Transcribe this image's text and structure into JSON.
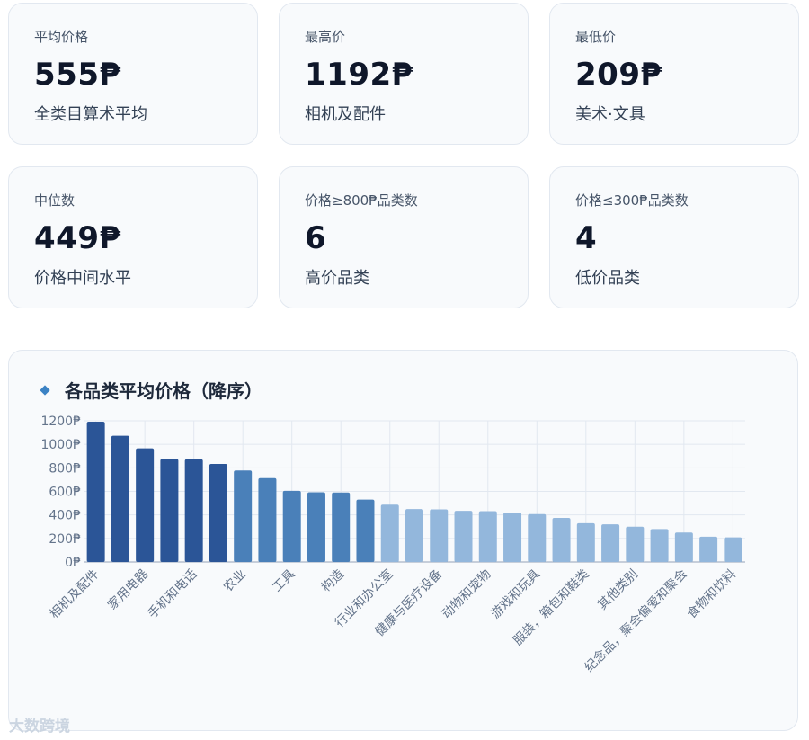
{
  "cards": [
    {
      "label": "平均价格",
      "value": "555₱",
      "sub": "全类目算术平均"
    },
    {
      "label": "最高价",
      "value": "1192₱",
      "sub": "相机及配件"
    },
    {
      "label": "最低价",
      "value": "209₱",
      "sub": "美术·文具"
    },
    {
      "label": "中位数",
      "value": "449₱",
      "sub": "价格中间水平"
    },
    {
      "label": "价格≥800₱品类数",
      "value": "6",
      "sub": "高价品类"
    },
    {
      "label": "价格≤300₱品类数",
      "value": "4",
      "sub": "低价品类"
    }
  ],
  "panel": {
    "title": "各品类平均价格（降序）"
  },
  "watermark": "大数跨境",
  "colors": {
    "high": "#2b5597",
    "mid": "#4a80b9",
    "low": "#93b7dc",
    "grid": "#e2e8f0",
    "axis": "#94a3b8",
    "tick": "#64748b"
  },
  "chart_data": {
    "type": "bar",
    "title": "各品类平均价格（降序）",
    "xlabel": "",
    "ylabel": "",
    "ylim": [
      0,
      1200
    ],
    "yticks": [
      "0₱",
      "200₱",
      "400₱",
      "600₱",
      "800₱",
      "1000₱",
      "1200₱"
    ],
    "grid": true,
    "categories": [
      "相机及配件",
      "",
      "家用电器",
      "",
      "手机和电话",
      "",
      "农业",
      "",
      "工具",
      "",
      "构造",
      "",
      "行业和办公室",
      "",
      "健康与医疗设备",
      "",
      "动物和宠物",
      "",
      "游戏和玩具",
      "",
      "服装，箱包和鞋类",
      "",
      "其他类别",
      "",
      "纪念品，聚会偏爱和聚会",
      "",
      "食物和饮料"
    ],
    "values": [
      1192,
      1073,
      966,
      875,
      873,
      833,
      778,
      713,
      605,
      592,
      590,
      530,
      487,
      450,
      447,
      435,
      432,
      420,
      407,
      375,
      330,
      320,
      300,
      280,
      250,
      215,
      209
    ],
    "tiers": [
      "high",
      "high",
      "high",
      "high",
      "high",
      "high",
      "mid",
      "mid",
      "mid",
      "mid",
      "mid",
      "mid",
      "low",
      "low",
      "low",
      "low",
      "low",
      "low",
      "low",
      "low",
      "low",
      "low",
      "low",
      "low",
      "low",
      "low",
      "low"
    ]
  }
}
